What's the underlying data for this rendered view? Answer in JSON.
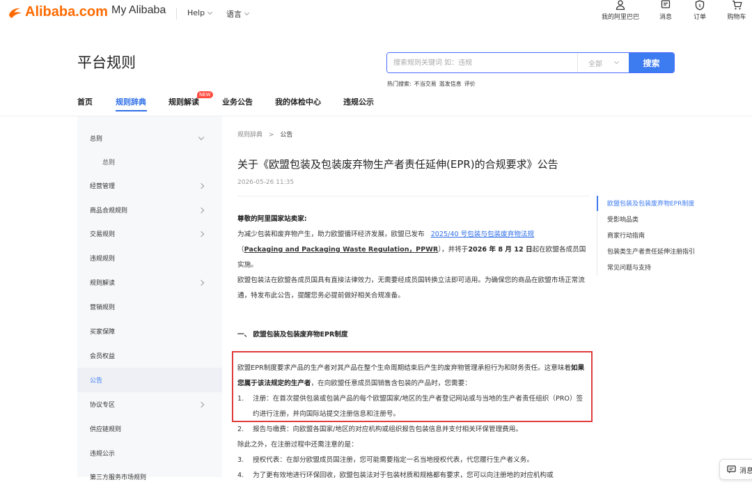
{
  "topbar": {
    "logo_text": "Alibaba.com",
    "my_alibaba": "My Alibaba",
    "help": "Help",
    "language": "语言",
    "right": [
      {
        "label": "我的阿里巴巴",
        "icon": "user-icon"
      },
      {
        "label": "消息",
        "icon": "message-icon"
      },
      {
        "label": "订单",
        "icon": "order-icon"
      },
      {
        "label": "购物车",
        "icon": "cart-icon"
      }
    ]
  },
  "header": {
    "title": "平台规则",
    "search": {
      "placeholder": "搜索规则关键词 如：违规",
      "scope": "全部",
      "button": "搜索"
    },
    "hot_label": "热门搜索:",
    "hot_terms": [
      "不当交易",
      "滥发信息",
      "评价"
    ]
  },
  "nav": {
    "items": [
      "首页",
      "规则辞典",
      "规则解读",
      "业务公告",
      "我的体检中心",
      "违规公示"
    ],
    "active_index": 1,
    "badge": "NEW"
  },
  "sidebar": {
    "items": [
      {
        "label": "总则",
        "arrow": "down"
      },
      {
        "label": "总则",
        "sub": true
      },
      {
        "label": "经营管理",
        "arrow": "right"
      },
      {
        "label": "商品合规规则",
        "arrow": "right"
      },
      {
        "label": "交易规则",
        "arrow": "right"
      },
      {
        "label": "违规规则"
      },
      {
        "label": "规则解读",
        "arrow": "right"
      },
      {
        "label": "营销规则"
      },
      {
        "label": "买家保障"
      },
      {
        "label": "会员权益"
      },
      {
        "label": "公告",
        "active": true
      },
      {
        "label": "协议专区",
        "arrow": "right"
      },
      {
        "label": "供应链规则"
      },
      {
        "label": "违规公示"
      },
      {
        "label": "第三方服务市场规则"
      }
    ]
  },
  "article": {
    "breadcrumb": [
      "规则辞典",
      "公告"
    ],
    "breadcrumb_sep": ">",
    "title": "关于《欧盟包装及包装废弃物生产者责任延伸(EPR)的合规要求》公告",
    "date": "2026-05-26 11:35",
    "greeting": "尊敬的阿里国家站卖家:",
    "p1_a": "为减少包装和废弃物产生，助力欧盟循环经济发展，欧盟已发布",
    "p1_link": "2025/40 号包装与包装废弃物法规",
    "p1_b": "（",
    "p1_reg": "Packaging and Packaging Waste Regulation，PPWR",
    "p1_c": "），并将于",
    "p1_date": "2026 年 8 月 12 日",
    "p1_d": "起在欧盟各成员国实施。",
    "p2": "欧盟包装法在欧盟各成员国具有直接法律效力，无需要经成员国转换立法即可适用。为确保您的商品在欧盟市场正常流通，特发布此公告，提醒您务必提前做好相关合规准备。",
    "section1": "一、  欧盟包装及包装废弃物EPR制度",
    "p3_a": "欧盟EPR制度要求产品的生产者对其产品在整个生命周期结束后产生的废弃物管理承担行为和财务责任。这意味着",
    "p3_bold": "如果您属于该法规定的生产者",
    "p3_b": "，在向欧盟任意成员国销售含包装的产品时，您需要：",
    "li1_num": "1.",
    "li1": "注册：在首次提供包装或包装产品的每个欧盟国家/地区的生产者登记网站或与当地的生产者责任组织（PRO）签约进行注册，并向国际站提交注册信息和注册号。",
    "li2_num": "2.",
    "li2": "报告与缴费：向欧盟各国家/地区的对应机构或组织报告包装信息并支付相关环保管理费用。",
    "p4": "除此之外，在注册过程中还需注意的是：",
    "li3_num": "3.",
    "li3": "授权代表：在部分欧盟成员国注册，您可能需要指定一名当地授权代表，代您履行生产者义务。",
    "li4_num": "4.",
    "li4": "为了更有效地进行环保回收，欧盟包装法对于包装材质和规格都有要求，您可以向注册地的对应机构或"
  },
  "toc": {
    "items": [
      "欧盟包装及包装废弃物EPR制度",
      "受影响品类",
      "商家行动指南",
      "包装类生产者责任延伸注册指引",
      "常见问题与支持"
    ],
    "active_index": 0
  },
  "float_button": "消息"
}
